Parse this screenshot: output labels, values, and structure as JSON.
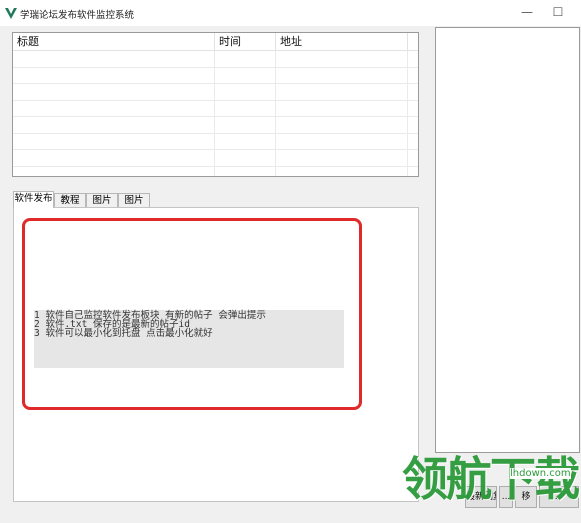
{
  "window": {
    "title": "学瑞论坛发布软件监控系统",
    "minimize_glyph": "—",
    "maximize_glyph": "☐"
  },
  "table": {
    "columns": [
      "标题",
      "时间",
      "地址"
    ],
    "row_count": 8
  },
  "tabs": [
    {
      "label": "软件发布",
      "active": true
    },
    {
      "label": "教程",
      "active": false
    },
    {
      "label": "图片",
      "active": false
    },
    {
      "label": "图片",
      "active": false
    }
  ],
  "tutorial": {
    "lines": [
      "1 软件自己监控软件发布板块 有新的帖子 会弹出提示",
      "2 软件.txt 保存的是最新的帖子id",
      "3 软件可以最小化到托盘 点击最小化就好"
    ]
  },
  "buttons": [
    {
      "label": "最新回复"
    },
    {
      "label": "..."
    },
    {
      "label": "移"
    },
    {
      "label": "..."
    }
  ],
  "watermark": {
    "logo": "领航下载",
    "site": "lhdown.com"
  },
  "colors": {
    "highlight_frame": "#e02a2a",
    "brand": "#2b9a3a"
  }
}
